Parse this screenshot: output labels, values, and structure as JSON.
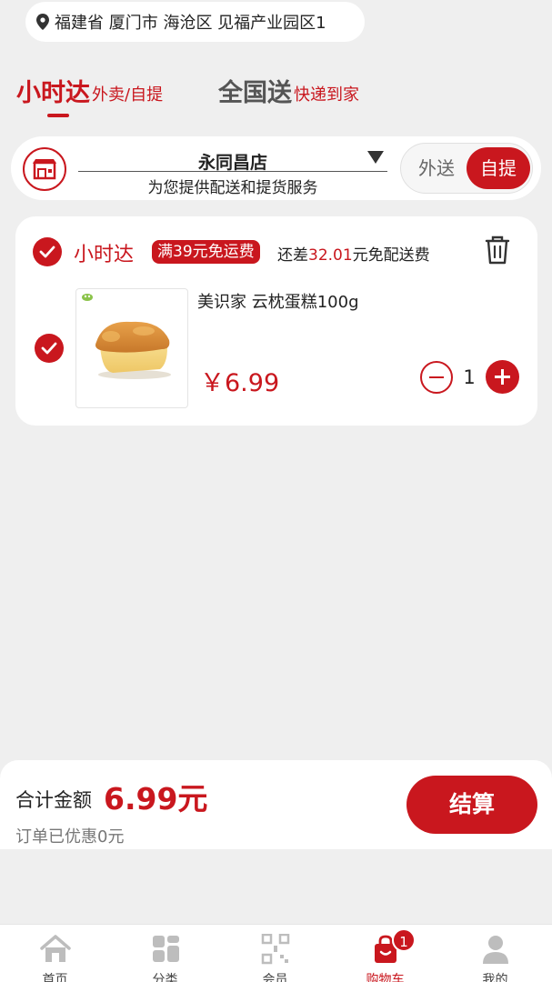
{
  "location": {
    "address": "福建省 厦门市 海沧区 见福产业园区1"
  },
  "mode_tabs": [
    {
      "title": "小时达",
      "subtitle": "外卖/自提",
      "active": true
    },
    {
      "title": "全国送",
      "subtitle": "快递到家",
      "active": false
    }
  ],
  "store": {
    "name": "永同昌店",
    "subtitle": "为您提供配送和提货服务",
    "toggle": {
      "delivery": "外送",
      "pickup": "自提",
      "selected": "自提"
    }
  },
  "cart_group": {
    "title": "小时达",
    "promo_badge": "满39元免运费",
    "promo_prefix": "还差",
    "promo_amount": "32.01",
    "promo_suffix": "元免配送费",
    "items": [
      {
        "name": "美识家 云枕蛋糕100g",
        "price": "￥6.99",
        "qty": "1",
        "checked": true
      }
    ]
  },
  "summary": {
    "total_label": "合计金额",
    "total_amount": "6.99元",
    "discount_text": "订单已优惠0元",
    "checkout_label": "结算"
  },
  "tabbar": {
    "items": [
      {
        "label": "首页",
        "icon": "home-icon"
      },
      {
        "label": "分类",
        "icon": "category-icon"
      },
      {
        "label": "会员",
        "icon": "member-qr-icon"
      },
      {
        "label": "购物车",
        "icon": "cart-icon",
        "active": true,
        "badge": "1"
      },
      {
        "label": "我的",
        "icon": "profile-icon"
      }
    ]
  },
  "colors": {
    "accent": "#c9171e",
    "background": "#efefef"
  }
}
